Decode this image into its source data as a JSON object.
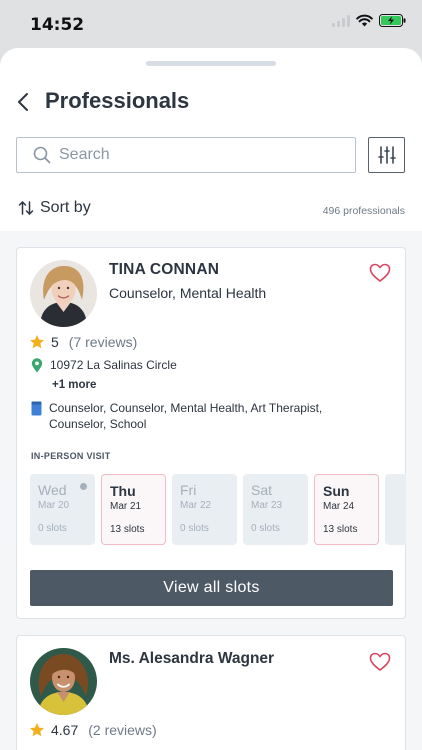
{
  "status": {
    "time": "14:52"
  },
  "header": {
    "title": "Professionals"
  },
  "search": {
    "placeholder": "Search"
  },
  "sort": {
    "label": "Sort by",
    "count": "496 professionals"
  },
  "cards": [
    {
      "name": "TINA CONNAN",
      "title": "Counselor, Mental Health",
      "rating": "5",
      "reviews": "(7 reviews)",
      "address": "10972 La Salinas Circle",
      "address_more": "+1 more",
      "specialties": "Counselor, Counselor, Mental Health, Art Therapist, Counselor, School",
      "visit_type": "IN-PERSON VISIT",
      "days": [
        {
          "day": "Wed",
          "date": "Mar 20",
          "slots": "0 slots",
          "available": false
        },
        {
          "day": "Thu",
          "date": "Mar 21",
          "slots": "13 slots",
          "available": true
        },
        {
          "day": "Fri",
          "date": "Mar 22",
          "slots": "0 slots",
          "available": false
        },
        {
          "day": "Sat",
          "date": "Mar 23",
          "slots": "0 slots",
          "available": false
        },
        {
          "day": "Sun",
          "date": "Mar 24",
          "slots": "13 slots",
          "available": true
        }
      ],
      "view_all": "View all slots"
    },
    {
      "name": "Ms. Alesandra Wagner",
      "rating": "4.67",
      "reviews": "(2 reviews)"
    }
  ],
  "colors": {
    "accent_heart": "#d9455f",
    "star": "#f2b01e",
    "pin": "#3aa76d",
    "doc": "#3f7fd6",
    "button": "#4e5966"
  }
}
